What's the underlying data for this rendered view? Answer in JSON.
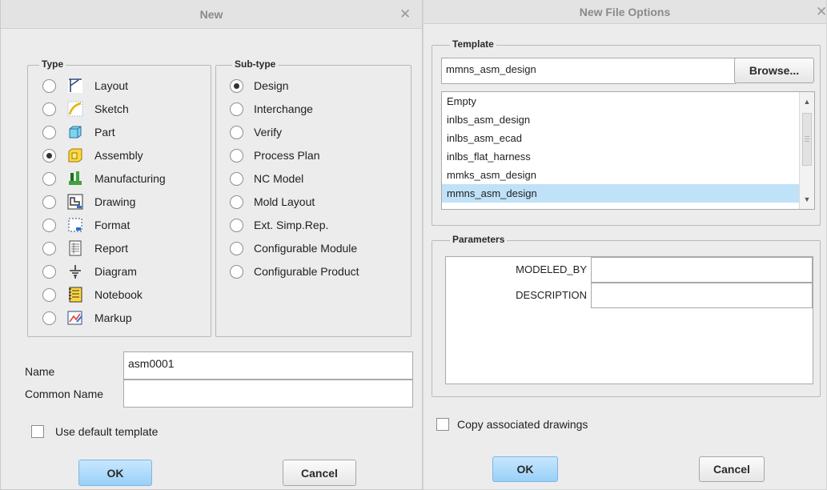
{
  "new_dialog": {
    "title": "New",
    "close_glyph": "✕",
    "type_group_label": "Type",
    "subtype_group_label": "Sub-type",
    "types": [
      {
        "label": "Layout",
        "icon": "layout-icon",
        "checked": false
      },
      {
        "label": "Sketch",
        "icon": "sketch-icon",
        "checked": false
      },
      {
        "label": "Part",
        "icon": "part-icon",
        "checked": false
      },
      {
        "label": "Assembly",
        "icon": "assembly-icon",
        "checked": true
      },
      {
        "label": "Manufacturing",
        "icon": "manufacturing-icon",
        "checked": false
      },
      {
        "label": "Drawing",
        "icon": "drawing-icon",
        "checked": false
      },
      {
        "label": "Format",
        "icon": "format-icon",
        "checked": false
      },
      {
        "label": "Report",
        "icon": "report-icon",
        "checked": false
      },
      {
        "label": "Diagram",
        "icon": "diagram-icon",
        "checked": false
      },
      {
        "label": "Notebook",
        "icon": "notebook-icon",
        "checked": false
      },
      {
        "label": "Markup",
        "icon": "markup-icon",
        "checked": false
      }
    ],
    "subtypes": [
      {
        "label": "Design",
        "checked": true
      },
      {
        "label": "Interchange",
        "checked": false
      },
      {
        "label": "Verify",
        "checked": false
      },
      {
        "label": "Process Plan",
        "checked": false
      },
      {
        "label": "NC Model",
        "checked": false
      },
      {
        "label": "Mold Layout",
        "checked": false
      },
      {
        "label": "Ext. Simp.Rep.",
        "checked": false
      },
      {
        "label": "Configurable Module",
        "checked": false
      },
      {
        "label": "Configurable Product",
        "checked": false
      }
    ],
    "name_label": "Name",
    "name_value": "asm0001",
    "common_name_label": "Common Name",
    "common_name_value": "",
    "use_default_template_label": "Use default template",
    "use_default_template_checked": false,
    "ok_label": "OK",
    "cancel_label": "Cancel"
  },
  "options_dialog": {
    "title": "New File Options",
    "close_glyph": "✕",
    "template_group_label": "Template",
    "template_value": "mmns_asm_design",
    "browse_label": "Browse...",
    "templates": [
      "Empty",
      "inlbs_asm_design",
      "inlbs_asm_ecad",
      "inlbs_flat_harness",
      "mmks_asm_design",
      "mmns_asm_design"
    ],
    "selected_template": "mmns_asm_design",
    "parameters_group_label": "Parameters",
    "parameters": [
      {
        "name": "MODELED_BY",
        "value": ""
      },
      {
        "name": "DESCRIPTION",
        "value": ""
      }
    ],
    "copy_drawings_label": "Copy associated drawings",
    "copy_drawings_checked": false,
    "ok_label": "OK",
    "cancel_label": "Cancel"
  },
  "colors": {
    "dialog_background": "#ececec",
    "title_text": "#8a8a8a",
    "primary_button": "#9ad0f7",
    "list_selection": "#c0e2f8"
  }
}
